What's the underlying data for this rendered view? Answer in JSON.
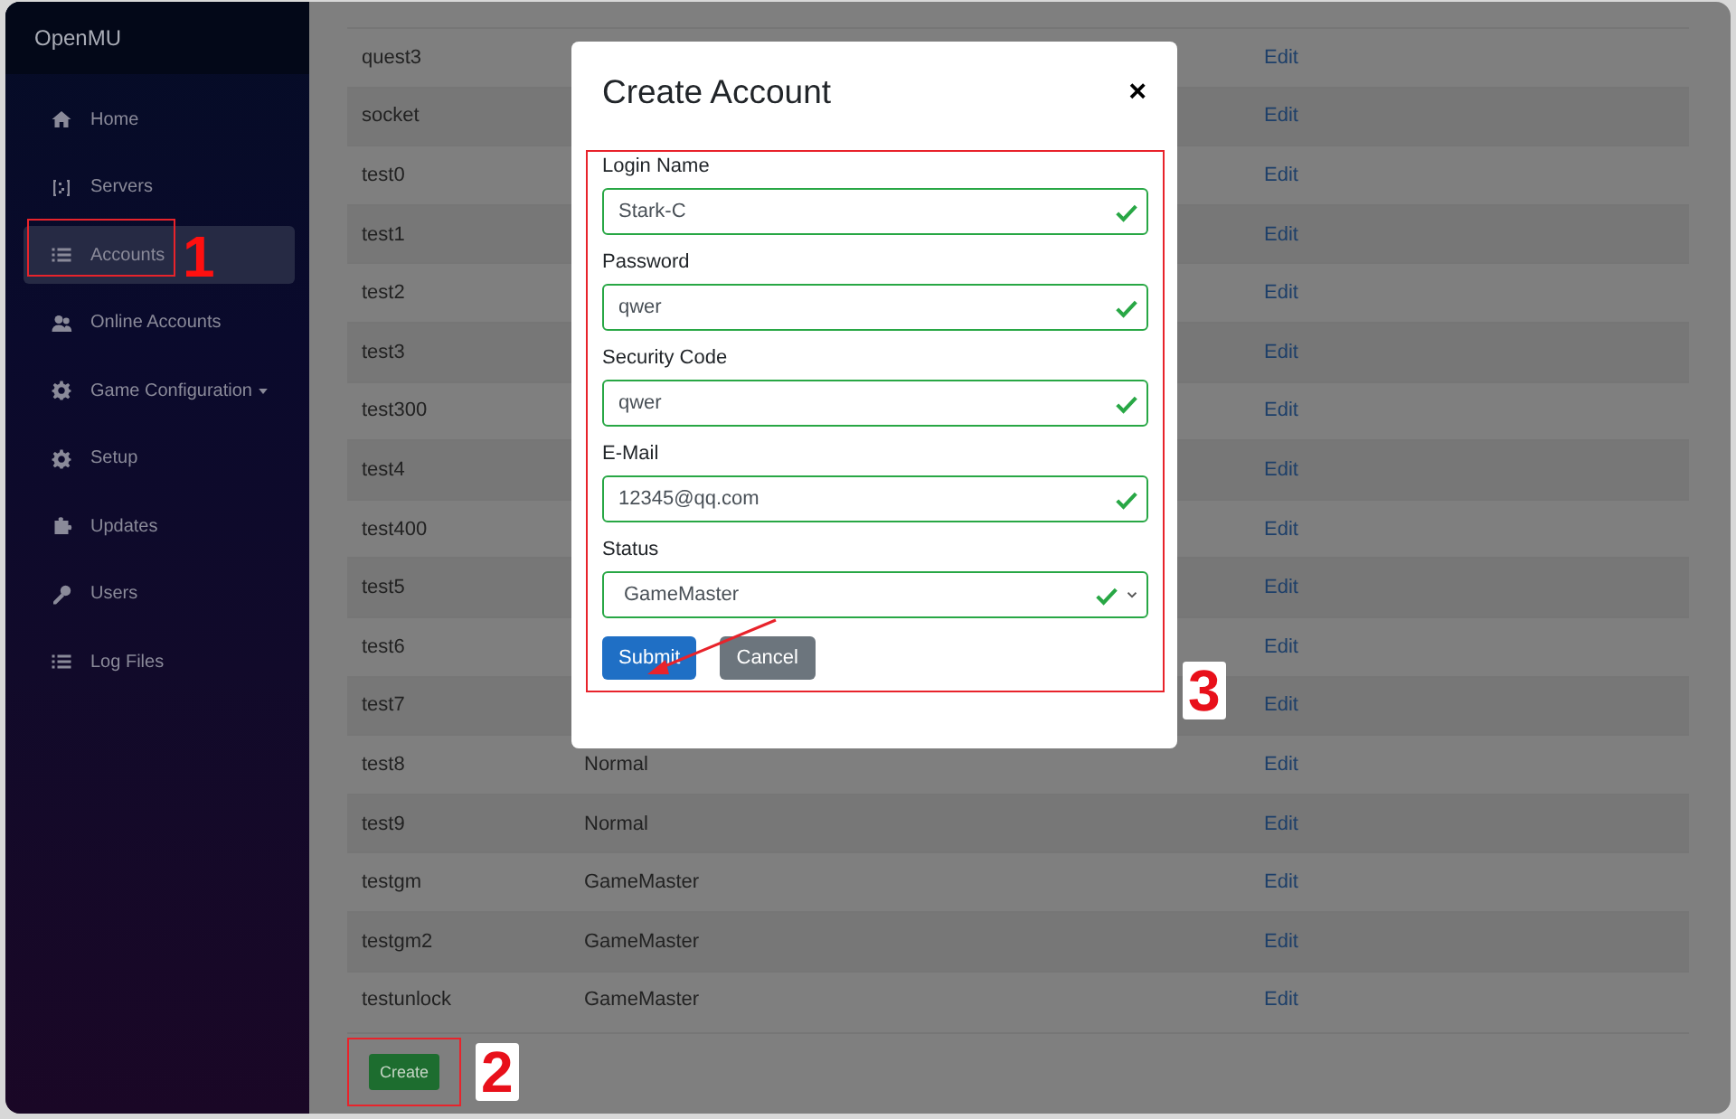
{
  "sidebar": {
    "brand": "OpenMU",
    "items": [
      {
        "label": "Home",
        "selected": false,
        "dropdown": false
      },
      {
        "label": "Servers",
        "selected": false,
        "dropdown": false
      },
      {
        "label": "Accounts",
        "selected": true,
        "dropdown": false,
        "marker": "1"
      },
      {
        "label": "Online Accounts",
        "selected": false,
        "dropdown": false
      },
      {
        "label": "Game Configuration",
        "selected": false,
        "dropdown": true
      },
      {
        "label": "Setup",
        "selected": false,
        "dropdown": false
      },
      {
        "label": "Updates",
        "selected": false,
        "dropdown": false
      },
      {
        "label": "Users",
        "selected": false,
        "dropdown": false
      },
      {
        "label": "Log Files",
        "selected": false,
        "dropdown": false
      }
    ]
  },
  "table": {
    "rows": [
      {
        "name": "quest3",
        "action": "Edit"
      },
      {
        "name": "socket",
        "action": "Edit"
      },
      {
        "name": "test0",
        "action": "Edit"
      },
      {
        "name": "test1",
        "action": "Edit"
      },
      {
        "name": "test2",
        "action": "Edit"
      },
      {
        "name": "test3",
        "action": "Edit"
      },
      {
        "name": "test300",
        "action": "Edit"
      },
      {
        "name": "test4",
        "action": "Edit"
      },
      {
        "name": "test400",
        "action": "Edit"
      },
      {
        "name": "test5",
        "action": "Edit"
      },
      {
        "name": "test6",
        "action": "Edit"
      },
      {
        "name": "test7",
        "action": "Edit"
      },
      {
        "name": "test8",
        "state": "Normal",
        "action": "Edit"
      },
      {
        "name": "test9",
        "state": "Normal",
        "action": "Edit"
      },
      {
        "name": "testgm",
        "state": "GameMaster",
        "action": "Edit"
      },
      {
        "name": "testgm2",
        "state": "GameMaster",
        "action": "Edit"
      },
      {
        "name": "testunlock",
        "state": "GameMaster",
        "action": "Edit"
      }
    ]
  },
  "create_button": {
    "label": "Create",
    "marker": "2"
  },
  "modal": {
    "title": "Create Account",
    "close": "×",
    "marker": "3",
    "fields": [
      {
        "kind": "text",
        "label": "Login Name",
        "value": "Stark-C",
        "valid": true
      },
      {
        "kind": "text",
        "label": "Password",
        "value": "qwer",
        "valid": true
      },
      {
        "kind": "text",
        "label": "Security Code",
        "value": "qwer",
        "valid": true
      },
      {
        "kind": "text",
        "label": "E-Mail",
        "value": "12345@qq.com",
        "valid": true
      },
      {
        "kind": "select",
        "label": "Status",
        "value": "GameMaster",
        "valid": true
      }
    ],
    "buttons": [
      {
        "label": "Submit",
        "kind": "primary"
      },
      {
        "label": "Cancel",
        "kind": "secondary"
      }
    ]
  }
}
